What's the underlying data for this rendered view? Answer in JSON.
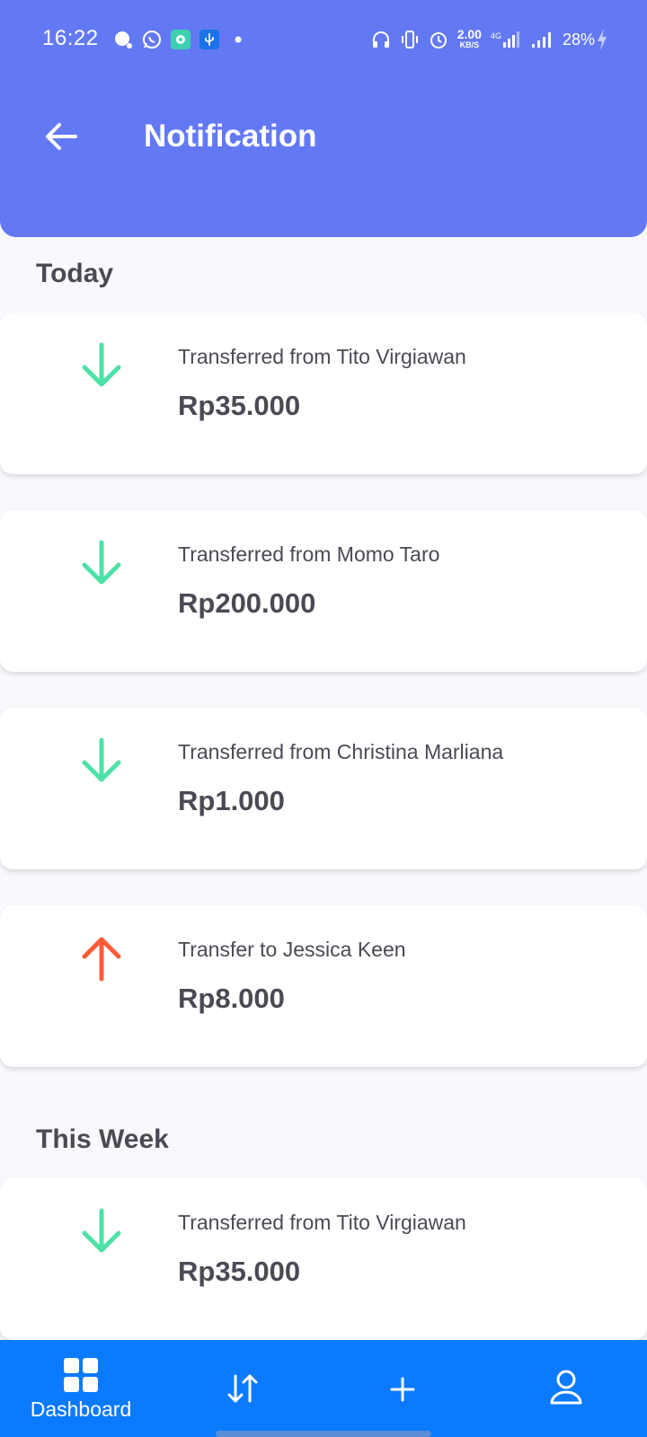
{
  "status_bar": {
    "time": "16:22",
    "network_speed_value": "2.00",
    "network_speed_unit": "KB/S",
    "network_type": "4G",
    "battery": "28%"
  },
  "header": {
    "title": "Notification"
  },
  "sections": [
    {
      "title": "Today",
      "items": [
        {
          "direction": "in",
          "text": "Transferred from Tito Virgiawan",
          "amount": "Rp35.000"
        },
        {
          "direction": "in",
          "text": "Transferred from Momo Taro",
          "amount": "Rp200.000"
        },
        {
          "direction": "in",
          "text": "Transferred from Christina Marliana",
          "amount": "Rp1.000"
        },
        {
          "direction": "out",
          "text": "Transfer to Jessica Keen",
          "amount": "Rp8.000"
        }
      ]
    },
    {
      "title": "This Week",
      "items": [
        {
          "direction": "in",
          "text": "Transferred from Tito Virgiawan",
          "amount": "Rp35.000"
        }
      ]
    }
  ],
  "bottom_nav": [
    {
      "label": "Dashboard",
      "icon": "dashboard-grid-icon"
    },
    {
      "label": "",
      "icon": "transfer-arrows-icon"
    },
    {
      "label": "",
      "icon": "plus-icon"
    },
    {
      "label": "",
      "icon": "user-profile-icon"
    }
  ],
  "colors": {
    "header": "#6379f4",
    "incoming": "#4ce2a7",
    "outgoing": "#ff5b37",
    "bottom_nav": "#0a7aff"
  }
}
